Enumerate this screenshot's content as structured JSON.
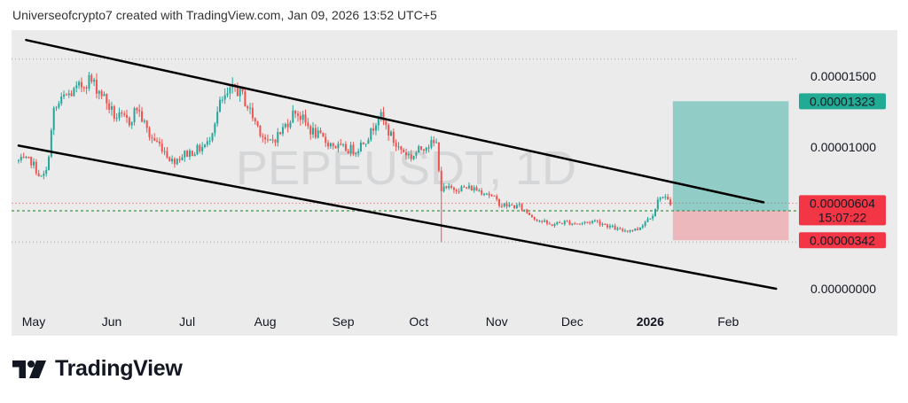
{
  "header": {
    "text": "Universeofcrypto7 created with TradingView.com, Jan 09, 2026 13:52 UTC+5"
  },
  "brand": {
    "name": "TradingView",
    "logo_icon": "tradingview-logo-icon"
  },
  "colors": {
    "up": "#26a69a",
    "down": "#ef5350",
    "current_price": "#ef5350",
    "target": "#26a69a",
    "stop": "#f23645",
    "channel": "#000000",
    "panel_bg": "#ebebeb"
  },
  "chart_data": {
    "type": "candlestick",
    "title": "",
    "watermark": "PEPEUSDT, 1D",
    "xlabel": "",
    "ylabel": "",
    "x_ticks": [
      "May",
      "Jun",
      "Jul",
      "Aug",
      "Sep",
      "Oct",
      "Nov",
      "Dec",
      "2026",
      "Feb"
    ],
    "y_ticks": [
      "0.00001500",
      "0.00001000",
      "0.00000000"
    ],
    "ylim": [
      0,
      1.745e-05
    ],
    "grid": false,
    "legend": "none",
    "series": [
      {
        "close_path": [
          [
            "2025-04-25",
            9e-06
          ],
          [
            "2025-04-30",
            9e-06
          ],
          [
            "2025-05-04",
            7.8e-06
          ],
          [
            "2025-05-06",
            8.2e-06
          ],
          [
            "2025-05-09",
            1.25e-05
          ],
          [
            "2025-05-13",
            1.35e-05
          ],
          [
            "2025-05-18",
            1.4e-05
          ],
          [
            "2025-05-23",
            1.48e-05
          ],
          [
            "2025-05-28",
            1.38e-05
          ],
          [
            "2025-06-02",
            1.22e-05
          ],
          [
            "2025-06-08",
            1.18e-05
          ],
          [
            "2025-06-11",
            1.28e-05
          ],
          [
            "2025-06-16",
            1.08e-05
          ],
          [
            "2025-06-21",
            1e-05
          ],
          [
            "2025-06-25",
            9e-06
          ],
          [
            "2025-06-30",
            9.5e-06
          ],
          [
            "2025-07-05",
            9.8e-06
          ],
          [
            "2025-07-09",
            1.02e-05
          ],
          [
            "2025-07-14",
            1.3e-05
          ],
          [
            "2025-07-20",
            1.42e-05
          ],
          [
            "2025-07-23",
            1.36e-05
          ],
          [
            "2025-07-28",
            1.18e-05
          ],
          [
            "2025-08-02",
            1.02e-05
          ],
          [
            "2025-08-07",
            1.1e-05
          ],
          [
            "2025-08-13",
            1.26e-05
          ],
          [
            "2025-08-19",
            1.12e-05
          ],
          [
            "2025-08-25",
            1.04e-05
          ],
          [
            "2025-08-31",
            9.9e-06
          ],
          [
            "2025-09-06",
            9.8e-06
          ],
          [
            "2025-09-12",
            1.1e-05
          ],
          [
            "2025-09-15",
            1.24e-05
          ],
          [
            "2025-09-22",
            1.01e-05
          ],
          [
            "2025-09-28",
            9.3e-06
          ],
          [
            "2025-10-04",
            1.02e-05
          ],
          [
            "2025-10-08",
            1.02e-05
          ],
          [
            "2025-10-10",
            7e-06
          ],
          [
            "2025-10-16",
            7.1e-06
          ],
          [
            "2025-10-22",
            7.1e-06
          ],
          [
            "2025-10-28",
            6.8e-06
          ],
          [
            "2025-11-03",
            5.9e-06
          ],
          [
            "2025-11-10",
            5.8e-06
          ],
          [
            "2025-11-16",
            5e-06
          ],
          [
            "2025-11-22",
            4.5e-06
          ],
          [
            "2025-11-28",
            4.7e-06
          ],
          [
            "2025-12-04",
            4.6e-06
          ],
          [
            "2025-12-10",
            4.8e-06
          ],
          [
            "2025-12-16",
            4.4e-06
          ],
          [
            "2025-12-20",
            4.1e-06
          ],
          [
            "2025-12-27",
            4.2e-06
          ],
          [
            "2026-01-02",
            5.3e-06
          ],
          [
            "2026-01-05",
            6.6e-06
          ],
          [
            "2026-01-09",
            6e-06
          ]
        ],
        "anomalous_wick": {
          "date": "2025-10-10",
          "low": 3.3e-06
        }
      }
    ],
    "channel_lines": [
      {
        "name": "upper",
        "points": [
          [
            "2025-04-28",
            1.755e-05
          ],
          [
            "2026-02-15",
            6.1e-06
          ]
        ]
      },
      {
        "name": "lower",
        "points": [
          [
            "2025-04-25",
            1.01e-05
          ],
          [
            "2026-02-20",
            0.0
          ]
        ]
      }
    ],
    "horizontal_levels": [
      {
        "name": "current-price",
        "value": 6.04e-06,
        "style": "dotted"
      },
      {
        "name": "entry",
        "value": 5.5e-06,
        "style": "dashed"
      },
      {
        "name": "range-high",
        "value": 1.62e-05,
        "style": "dotted"
      },
      {
        "name": "range-low",
        "value": 3.3e-06,
        "style": "dotted"
      }
    ],
    "position": {
      "entry": 5.5e-06,
      "target": 1.323e-05,
      "stop": 3.42e-06,
      "start": "2026-01-10",
      "end": "2026-02-25"
    },
    "price_labels": [
      {
        "name": "target",
        "text": "0.00001323",
        "value": 1.323e-05
      },
      {
        "name": "current-price",
        "text": "0.00000604",
        "value": 6.04e-06,
        "sub": "15:07:22"
      },
      {
        "name": "stop",
        "text": "0.00000342",
        "value": 3.42e-06
      }
    ]
  }
}
